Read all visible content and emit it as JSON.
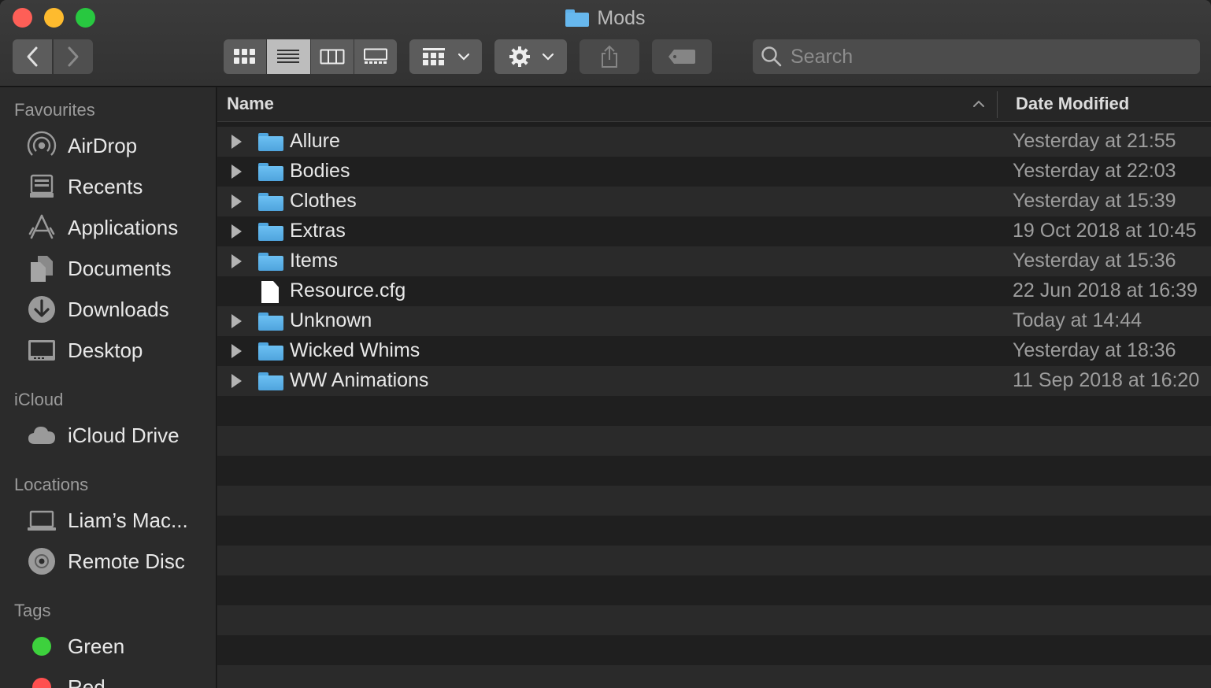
{
  "window": {
    "title": "Mods"
  },
  "toolbar": {
    "back_icon": "chevron-left-icon",
    "forward_icon": "chevron-right-icon",
    "search_placeholder": "Search"
  },
  "sidebar": {
    "sections": [
      {
        "heading": "Favourites",
        "items": [
          {
            "label": "AirDrop",
            "icon": "airdrop-icon"
          },
          {
            "label": "Recents",
            "icon": "recents-icon"
          },
          {
            "label": "Applications",
            "icon": "applications-icon"
          },
          {
            "label": "Documents",
            "icon": "documents-icon"
          },
          {
            "label": "Downloads",
            "icon": "downloads-icon"
          },
          {
            "label": "Desktop",
            "icon": "desktop-icon"
          }
        ]
      },
      {
        "heading": "iCloud",
        "items": [
          {
            "label": "iCloud Drive",
            "icon": "cloud-icon"
          }
        ]
      },
      {
        "heading": "Locations",
        "items": [
          {
            "label": "Liam’s Mac...",
            "icon": "laptop-icon"
          },
          {
            "label": "Remote Disc",
            "icon": "disc-icon"
          }
        ]
      },
      {
        "heading": "Tags",
        "items": [
          {
            "label": "Green",
            "icon": "tag-dot-icon",
            "color": "#3dd13d"
          },
          {
            "label": "Red",
            "icon": "tag-dot-icon",
            "color": "#ff4f4f"
          }
        ]
      }
    ]
  },
  "list": {
    "columns": {
      "name": "Name",
      "date": "Date Modified"
    },
    "rows": [
      {
        "name": "Allure",
        "date": "Yesterday at 21:55",
        "type": "folder"
      },
      {
        "name": "Bodies",
        "date": "Yesterday at 22:03",
        "type": "folder"
      },
      {
        "name": "Clothes",
        "date": "Yesterday at 15:39",
        "type": "folder"
      },
      {
        "name": "Extras",
        "date": "19 Oct 2018 at 10:45",
        "type": "folder"
      },
      {
        "name": "Items",
        "date": "Yesterday at 15:36",
        "type": "folder"
      },
      {
        "name": "Resource.cfg",
        "date": "22 Jun 2018 at 16:39",
        "type": "file"
      },
      {
        "name": "Unknown",
        "date": "Today at 14:44",
        "type": "folder"
      },
      {
        "name": "Wicked Whims",
        "date": "Yesterday at 18:36",
        "type": "folder"
      },
      {
        "name": "WW Animations",
        "date": "11 Sep 2018 at 16:20",
        "type": "folder"
      }
    ]
  }
}
